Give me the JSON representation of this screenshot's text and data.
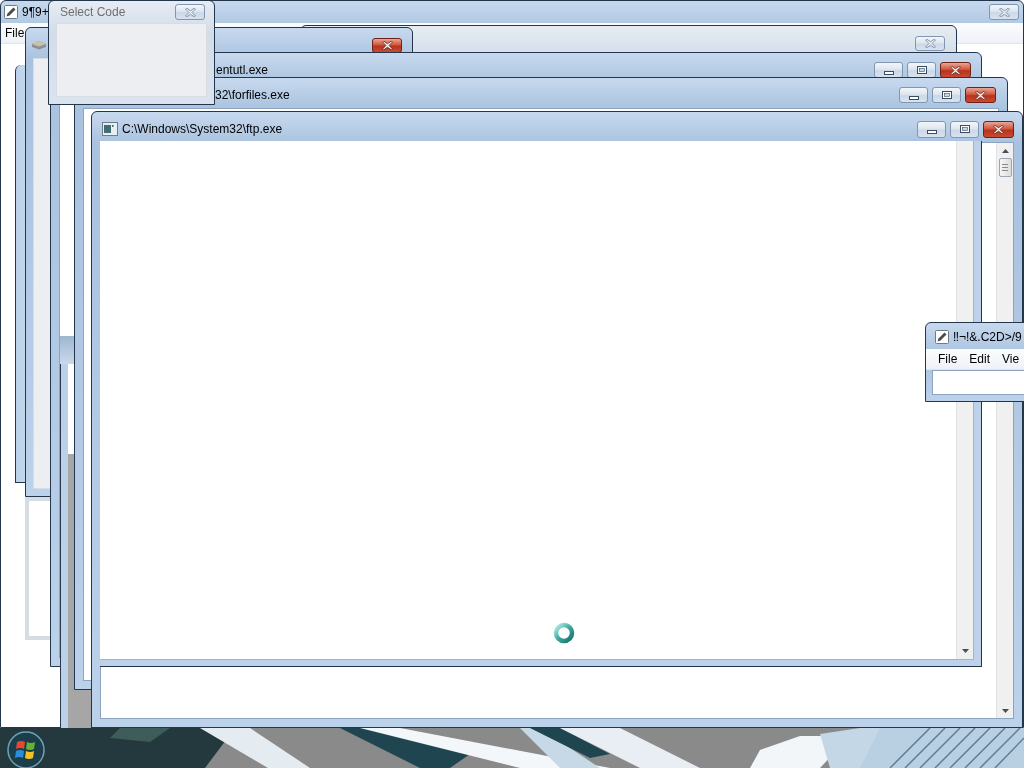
{
  "windows": [
    {
      "title": "9¶9+",
      "active": true,
      "menu": [
        "File"
      ],
      "buttons": [
        {
          "kind": "close",
          "highlighted": false
        }
      ]
    },
    {
      "active": false,
      "buttons": [
        {
          "kind": "close",
          "highlighted": false
        }
      ]
    },
    {
      "active": true,
      "buttons": [
        {
          "kind": "close",
          "highlighted": true
        }
      ]
    },
    {
      "title": "entutl.exe",
      "active": true,
      "buttons": [
        {
          "kind": "minimize",
          "highlighted": false
        },
        {
          "kind": "maximize",
          "highlighted": false
        },
        {
          "kind": "close",
          "highlighted": true
        }
      ]
    },
    {
      "title": "32\\forfiles.exe",
      "active": true,
      "buttons": [
        {
          "kind": "minimize",
          "highlighted": false
        },
        {
          "kind": "maximize",
          "highlighted": false
        },
        {
          "kind": "close",
          "highlighted": true
        }
      ]
    },
    {
      "title": "C:\\Windows\\System32\\ftp.exe",
      "active": true,
      "buttons": [
        {
          "kind": "minimize",
          "highlighted": false
        },
        {
          "kind": "maximize",
          "highlighted": false
        },
        {
          "kind": "close",
          "highlighted": true
        }
      ]
    },
    {
      "title": "Select Code",
      "active": false,
      "buttons": [
        {
          "kind": "close",
          "highlighted": false
        }
      ]
    },
    {
      "title": "‼¬!&.C2D>/9",
      "active": true,
      "menu": [
        "File",
        "Edit",
        "Vie"
      ]
    }
  ]
}
